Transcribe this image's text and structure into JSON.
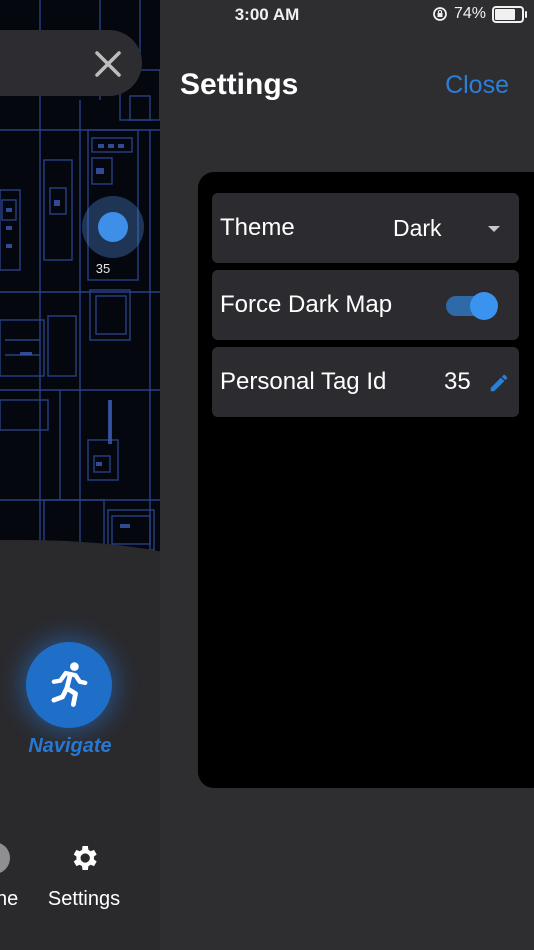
{
  "status_bar": {
    "time": "3:00 AM",
    "battery_percent": "74%",
    "icons": [
      "orientation-lock-icon",
      "battery-icon"
    ]
  },
  "map": {
    "tag_marker_label": "35"
  },
  "navigate": {
    "label": "Navigate",
    "icon": "running-person-icon"
  },
  "tab_bar": {
    "items": [
      {
        "label": "ne",
        "icon": "home-icon"
      },
      {
        "label": "Settings",
        "icon": "gear-icon"
      }
    ]
  },
  "settings": {
    "title": "Settings",
    "close_label": "Close",
    "rows": {
      "theme": {
        "label": "Theme",
        "value": "Dark"
      },
      "force_dark_map": {
        "label": "Force Dark Map",
        "enabled": true
      },
      "personal_tag": {
        "label": "Personal Tag Id",
        "value": "35"
      }
    }
  },
  "colors": {
    "accent": "#2b7fd6",
    "background": "#2e2e31",
    "card": "#000000",
    "row": "#2c2c30"
  }
}
